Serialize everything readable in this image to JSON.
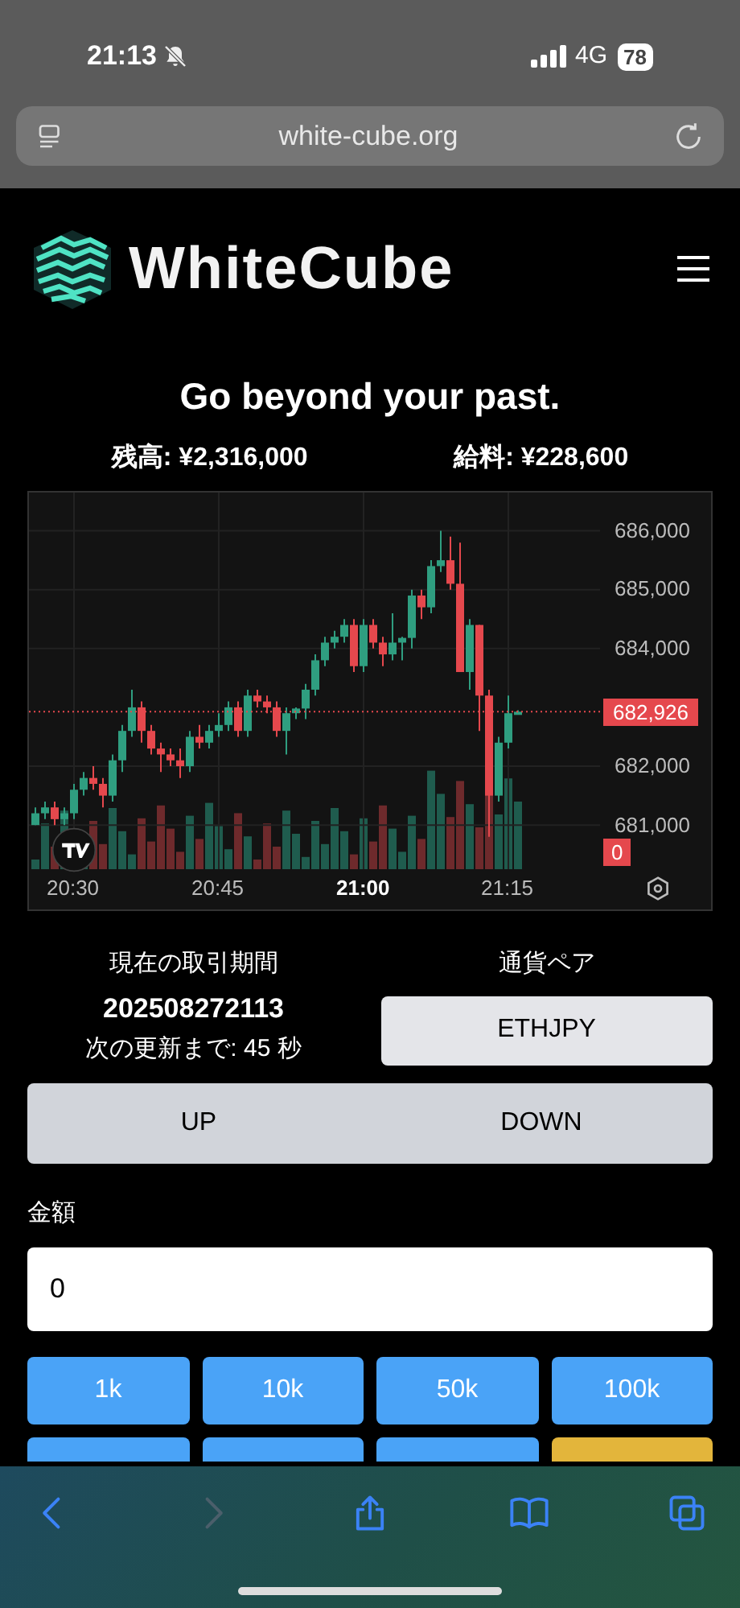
{
  "status_bar": {
    "time": "21:13",
    "network": "4G",
    "battery": "78"
  },
  "browser": {
    "url": "white-cube.org"
  },
  "header": {
    "brand": "WhiteCube"
  },
  "hero": {
    "title": "Go beyond your past."
  },
  "balances": [
    {
      "label": "残高: ¥2,316,000"
    },
    {
      "label": "給料: ¥228,600"
    }
  ],
  "chart": {
    "chart_data": {
      "type": "candlestick",
      "categories": [
        null,
        null,
        null,
        null,
        "20:30",
        null,
        null,
        null,
        null,
        null,
        null,
        null,
        null,
        null,
        null,
        null,
        null,
        null,
        null,
        "20:45",
        null,
        null,
        null,
        null,
        null,
        null,
        null,
        null,
        null,
        null,
        null,
        null,
        null,
        null,
        "21:00",
        null,
        null,
        null,
        null,
        null,
        null,
        null,
        null,
        null,
        null,
        null,
        null,
        null,
        null,
        "21:15",
        null
      ],
      "ylim": [
        680250,
        686650
      ],
      "grid": true,
      "ref_lines": [
        {
          "axis": "y",
          "value": 682926,
          "label": "682,926"
        }
      ],
      "ohlc": [
        [
          681000,
          681300,
          681000,
          681200
        ],
        [
          681200,
          681400,
          681100,
          681300
        ],
        [
          681300,
          681400,
          681000,
          681100
        ],
        [
          681100,
          681300,
          681000,
          681200
        ],
        [
          681200,
          681700,
          681100,
          681600
        ],
        [
          681600,
          681900,
          681500,
          681800
        ],
        [
          681800,
          682000,
          681600,
          681700
        ],
        [
          681700,
          681800,
          681300,
          681500
        ],
        [
          681500,
          682200,
          681400,
          682100
        ],
        [
          682100,
          682700,
          681900,
          682600
        ],
        [
          682600,
          683300,
          682500,
          683000
        ],
        [
          683000,
          683100,
          682400,
          682600
        ],
        [
          682600,
          682700,
          682200,
          682300
        ],
        [
          682300,
          682400,
          681900,
          682200
        ],
        [
          682200,
          682300,
          682000,
          682100
        ],
        [
          682100,
          682300,
          681800,
          682000
        ],
        [
          682000,
          682600,
          681900,
          682500
        ],
        [
          682500,
          682700,
          682300,
          682400
        ],
        [
          682400,
          682700,
          682300,
          682600
        ],
        [
          682600,
          682900,
          682500,
          682700
        ],
        [
          682700,
          683100,
          682600,
          683000
        ],
        [
          683000,
          683100,
          682500,
          682600
        ],
        [
          682600,
          683300,
          682500,
          683200
        ],
        [
          683200,
          683300,
          683000,
          683100
        ],
        [
          683100,
          683200,
          682900,
          683000
        ],
        [
          683000,
          683100,
          682500,
          682600
        ],
        [
          682600,
          683000,
          682200,
          682900
        ],
        [
          682900,
          683000,
          682800,
          682980
        ],
        [
          682980,
          683400,
          682800,
          683300
        ],
        [
          683300,
          683900,
          683200,
          683800
        ],
        [
          683800,
          684200,
          683700,
          684100
        ],
        [
          684100,
          684300,
          684000,
          684200
        ],
        [
          684200,
          684500,
          684100,
          684400
        ],
        [
          684400,
          684500,
          683600,
          683700
        ],
        [
          683700,
          684500,
          683600,
          684400
        ],
        [
          684400,
          684500,
          684000,
          684100
        ],
        [
          684100,
          684200,
          683700,
          683900
        ],
        [
          683900,
          684600,
          683800,
          684100
        ],
        [
          684100,
          684200,
          683800,
          684180
        ],
        [
          684180,
          685000,
          684000,
          684900
        ],
        [
          684900,
          685000,
          684500,
          684700
        ],
        [
          684700,
          685500,
          684600,
          685400
        ],
        [
          685400,
          686000,
          685300,
          685500
        ],
        [
          685500,
          685900,
          685000,
          685100
        ],
        [
          685100,
          685800,
          683600,
          683600
        ],
        [
          683600,
          684500,
          683300,
          684400
        ],
        [
          684400,
          684400,
          682600,
          683200
        ],
        [
          683200,
          683300,
          680800,
          681500
        ],
        [
          681500,
          682500,
          681400,
          682400
        ],
        [
          682400,
          683200,
          682300,
          682900
        ],
        [
          682900,
          682950,
          682900,
          682926
        ]
      ],
      "yticks": [
        {
          "value": 686000,
          "label": "686,000"
        },
        {
          "value": 685000,
          "label": "685,000"
        },
        {
          "value": 684000,
          "label": "684,000"
        },
        {
          "value": 682000,
          "label": "682,000"
        },
        {
          "value": 681000,
          "label": "681,000"
        }
      ]
    },
    "x_label_emphasis": [
      false,
      false,
      true,
      false
    ],
    "volume_tag": "0"
  },
  "period": {
    "label": "現在の取引期間",
    "value": "202508272113",
    "countdown": "次の更新まで: 45 秒"
  },
  "pair": {
    "label": "通貨ペア",
    "value": "ETHJPY"
  },
  "direction": [
    {
      "label": "UP",
      "selected": false
    },
    {
      "label": "DOWN",
      "selected": false
    }
  ],
  "amount": {
    "label": "金額",
    "value": "0"
  },
  "presets": [
    {
      "label": "1k",
      "color": "#4aa3f7"
    },
    {
      "label": "10k",
      "color": "#4aa3f7"
    },
    {
      "label": "50k",
      "color": "#4aa3f7"
    },
    {
      "label": "100k",
      "color": "#4aa3f7"
    },
    {
      "color": "#4aa3f7"
    },
    {
      "color": "#4aa3f7"
    },
    {
      "color": "#4aa3f7"
    },
    {
      "color": "#e3b53b"
    }
  ],
  "toolbar": [
    {
      "kind": "back",
      "disabled": false
    },
    {
      "kind": "forward",
      "disabled": true
    },
    {
      "kind": "share",
      "disabled": false
    },
    {
      "kind": "bookmarks",
      "disabled": false
    },
    {
      "kind": "tabs",
      "disabled": false
    }
  ]
}
